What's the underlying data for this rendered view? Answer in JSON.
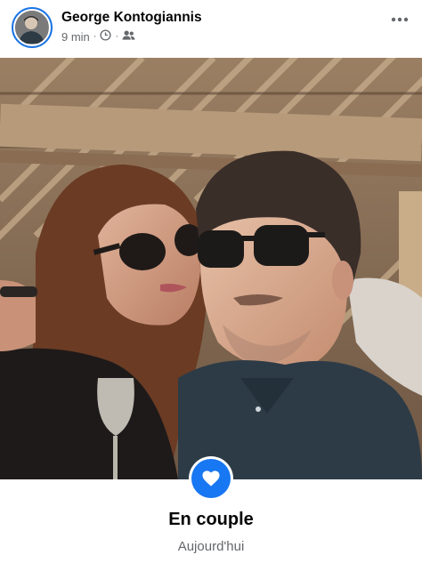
{
  "post": {
    "author": "George Kontogiannis",
    "time": "9 min",
    "separator": "·",
    "privacy_icon": "friends-icon",
    "clock_icon": "clock-icon",
    "more_icon": "more-horizontal-icon"
  },
  "life_event": {
    "icon": "heart-icon",
    "title": "En couple",
    "date": "Aujourd'hui"
  },
  "colors": {
    "accent": "#1877f2",
    "secondary_text": "#65676b",
    "primary_text": "#050505"
  }
}
